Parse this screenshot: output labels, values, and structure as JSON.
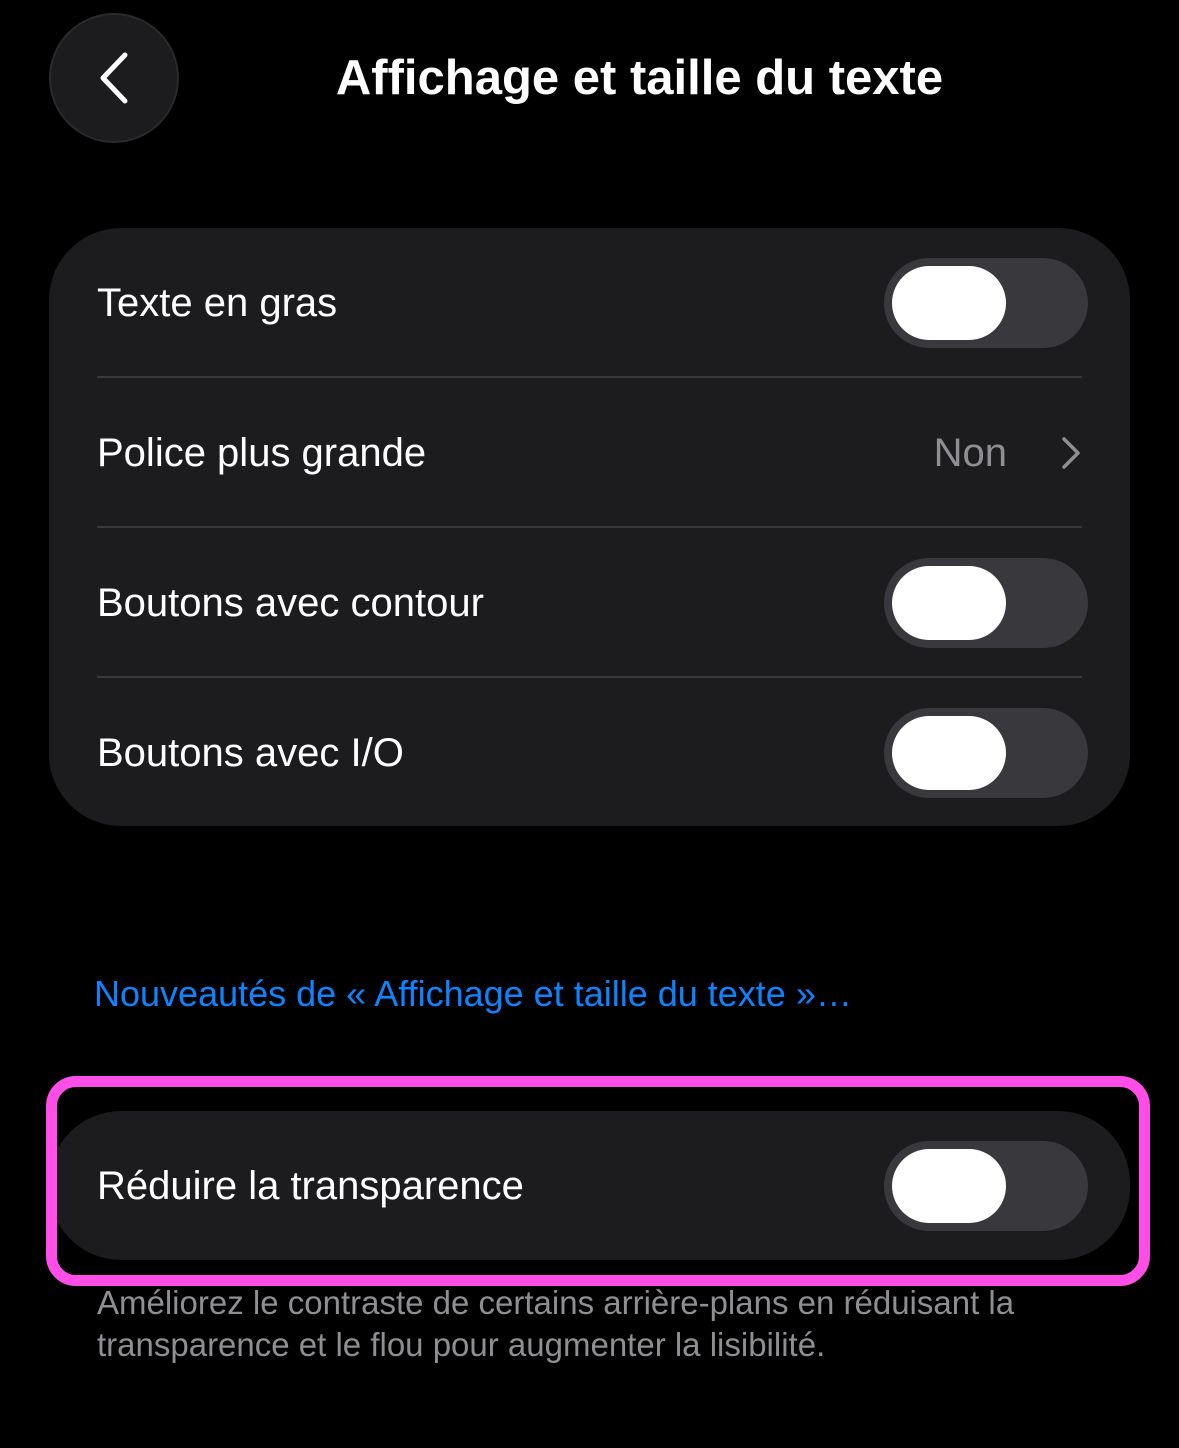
{
  "header": {
    "title": "Affichage et taille du texte",
    "back_icon": "chevron-left-icon"
  },
  "settings": [
    {
      "label": "Texte en gras",
      "type": "toggle",
      "on": false
    },
    {
      "label": "Police plus grande",
      "type": "link",
      "value": "Non"
    },
    {
      "label": "Boutons avec contour",
      "type": "toggle",
      "on": false
    },
    {
      "label": "Boutons avec I/O",
      "type": "toggle",
      "on": false
    }
  ],
  "whats_new_link": "Nouveautés de « Affichage et taille du texte »…",
  "transparency": {
    "label": "Réduire la transparence",
    "on": false,
    "footnote": "Améliorez le contraste de certains arrière-plans en réduisant la transparence et le flou pour augmenter la lisibilité."
  },
  "colors": {
    "background": "#000000",
    "group": "#1c1c1e",
    "toggle_off": "#39393d",
    "link": "#0a84ff",
    "secondary_text": "#8e8e93",
    "highlight": "#ff4de8"
  }
}
